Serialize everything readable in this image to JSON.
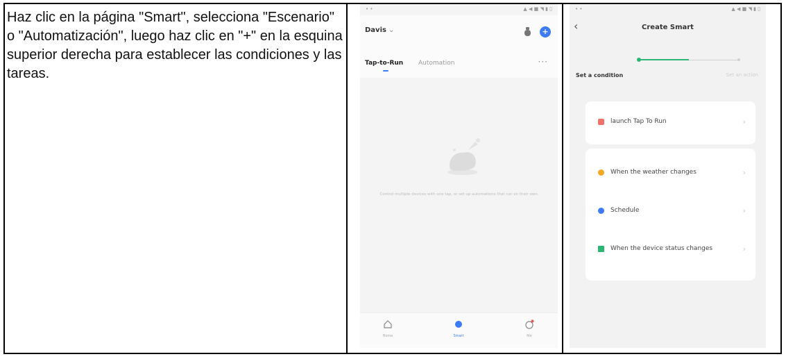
{
  "instruction": {
    "text": "Haz clic en la página \"Smart\", selecciona \"Escenario\" o \"Automatización\", luego haz clic en \"+\" en la esquina superior derecha para establecer las condiciones y las tareas."
  },
  "phone1": {
    "home_name": "Davis",
    "tabs": [
      {
        "label": "Tap-to-Run",
        "active": true
      },
      {
        "label": "Automation",
        "active": false
      }
    ],
    "empty_state_text": "Control multiple devices with one tap, or set up automations that run on their own.",
    "bottom_nav": [
      {
        "label": "Home",
        "icon": "home-icon",
        "active": false
      },
      {
        "label": "Smart",
        "icon": "smart-icon",
        "active": true
      },
      {
        "label": "Me",
        "icon": "me-icon",
        "active": false
      }
    ],
    "accent_color": "#3e7bf7"
  },
  "phone2": {
    "title": "Create Smart",
    "steps": [
      {
        "label": "Set a condition",
        "active": true
      },
      {
        "label": "Set an action",
        "active": false
      }
    ],
    "card1_rows": [
      {
        "label": "launch Tap To Run",
        "icon_color": "#f0706a"
      }
    ],
    "card2_rows": [
      {
        "label": "When the weather changes",
        "icon_color": "#f5a623"
      },
      {
        "label": "Schedule",
        "icon_color": "#3e7bf7"
      },
      {
        "label": "When the device status changes",
        "icon_color": "#2bb673"
      }
    ],
    "progress_color": "#2bb673"
  }
}
